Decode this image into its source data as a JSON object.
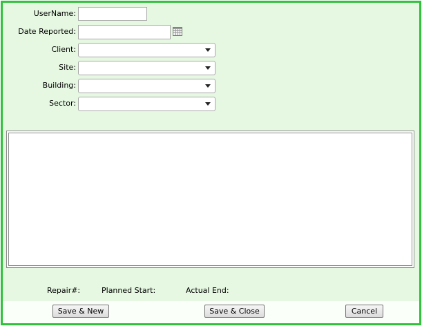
{
  "form": {
    "username": {
      "label": "UserName:",
      "value": ""
    },
    "date_reported": {
      "label": "Date Reported:",
      "value": "",
      "icon": "calendar-icon"
    },
    "client": {
      "label": "Client:",
      "value": ""
    },
    "site": {
      "label": "Site:",
      "value": ""
    },
    "building": {
      "label": "Building:",
      "value": ""
    },
    "sector": {
      "label": "Sector:",
      "value": ""
    }
  },
  "notes": {
    "value": ""
  },
  "info": {
    "repair_label": "Repair#:",
    "planned_start_label": "Planned Start:",
    "actual_end_label": "Actual End:"
  },
  "buttons": {
    "save_new": "Save & New",
    "save_close": "Save & Close",
    "cancel": "Cancel"
  },
  "colors": {
    "border": "#2fc23a",
    "background": "#e6f8e2"
  }
}
